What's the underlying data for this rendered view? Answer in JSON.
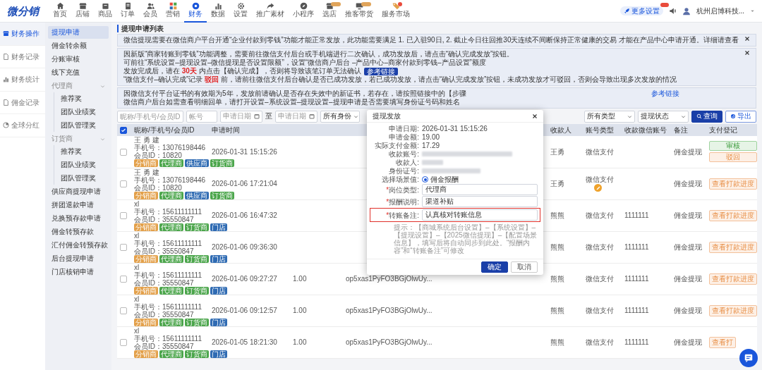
{
  "top_nav": {
    "logo": "微分销",
    "items": [
      {
        "label": "首页",
        "selected": false,
        "badge": false
      },
      {
        "label": "店铺",
        "selected": false,
        "badge": false
      },
      {
        "label": "商品",
        "selected": false,
        "badge": false
      },
      {
        "label": "订单",
        "selected": false,
        "badge": false
      },
      {
        "label": "会员",
        "selected": false,
        "badge": false
      },
      {
        "label": "营销",
        "selected": false,
        "badge": false
      },
      {
        "label": "财务",
        "selected": true,
        "badge": false
      },
      {
        "label": "数据",
        "selected": false,
        "badge": false
      },
      {
        "label": "设置",
        "selected": false,
        "badge": false
      },
      {
        "label": "推广素材",
        "selected": false,
        "badge": false
      },
      {
        "label": "小程序",
        "selected": false,
        "badge": false
      },
      {
        "label": "选店",
        "selected": false,
        "badge": true
      },
      {
        "label": "推客带货",
        "selected": false,
        "badge": true
      },
      {
        "label": "服务市场",
        "selected": false,
        "badge": true
      }
    ],
    "more_settings": {
      "label": "更多设置",
      "badge": true
    },
    "account": "杭州启博科技..."
  },
  "sidebar": {
    "items": [
      {
        "label": "财务操作",
        "selected": true
      },
      {
        "label": "财务记录",
        "selected": false
      },
      {
        "label": "财务统计",
        "selected": false
      },
      {
        "label": "佣金记录",
        "selected": false
      },
      {
        "label": "全球分红",
        "selected": false
      }
    ]
  },
  "subnav": {
    "items": [
      {
        "label": "提现申请",
        "selected": true
      },
      {
        "label": "佣金转余额",
        "selected": false
      },
      {
        "label": "分账审核",
        "selected": false
      },
      {
        "label": "线下充值",
        "selected": false
      },
      {
        "label": "代理商",
        "expanded": true,
        "children": [
          {
            "label": "推荐奖",
            "selected": false
          },
          {
            "label": "团队业绩奖",
            "selected": false
          },
          {
            "label": "团队管理奖",
            "selected": false
          }
        ]
      },
      {
        "label": "订货商",
        "expanded": true,
        "children": [
          {
            "label": "推荐奖",
            "selected": false
          },
          {
            "label": "团队业绩奖",
            "selected": false
          },
          {
            "label": "团队管理奖",
            "selected": false
          }
        ]
      },
      {
        "label": "供应商提现申请",
        "selected": false
      },
      {
        "label": "拼团退款申请",
        "selected": false
      },
      {
        "label": "兑换预存款申请",
        "selected": false
      },
      {
        "label": "佣金转预存款",
        "selected": false
      },
      {
        "label": "汇付佣金转预存款",
        "selected": false
      },
      {
        "label": "后台提现申请",
        "selected": false
      },
      {
        "label": "门店核销申请",
        "selected": false
      }
    ]
  },
  "page_title": "提现申请列表",
  "notices": [
    {
      "closable": true,
      "lines": [
        [
          {
            "kind": "text",
            "text": "微信提现需要在微信商户平台开通“企业付款到零钱”功能才能正常发放，此功能需要满足 1. 已入驻90日, 2. 截止今日往回推30天连续不间断保持正常健康的交易 才能在产品中心申请开通。详细请查看"
          }
        ]
      ]
    },
    {
      "closable": true,
      "lines": [
        [
          {
            "kind": "text",
            "text": "因新版“商家转账到零钱”功能调整，需要前往微信支付后台或手机端进行二次确认，成功发放后，请点击“确认完成发放”按钮。"
          }
        ],
        [
          {
            "kind": "text",
            "text": "可前往“系统设置–提现设置–微信提现是否设置限额”，设置“微信商户后台 –产品中心–商家付款到零钱–产品设置”额度"
          }
        ],
        [
          {
            "kind": "text",
            "text": "发放完成后，请在 "
          },
          {
            "kind": "alert",
            "text": "30天"
          },
          {
            "kind": "text",
            "text": " 内点击【确认完成】，否则将导致该笔订单无法确认"
          },
          {
            "kind": "button",
            "text": "参考链接"
          }
        ],
        [
          {
            "kind": "text",
            "text": "“微信支付–确认完成”记录 "
          },
          {
            "kind": "alert",
            "text": "驳回"
          },
          {
            "kind": "text",
            "text": " 前，请前往微信支付后台确认是否已成功发放，若已成功发放，请点击“确认完成发放”按钮，未成功发放才可驳回，否则会导致出现多次发放的情况"
          }
        ]
      ]
    },
    {
      "closable": false,
      "lines": [
        [
          {
            "kind": "text",
            "text": "因微信支付平台证书的有效期为5年，发放前请确认是否存在失效中的新证书，若存在，请按照链接中的【步骤"
          },
          {
            "kind": "link",
            "text": "参考链接"
          }
        ],
        [
          {
            "kind": "text",
            "text": "微信商户后台如需查看明细回单，请打开设置–系统设置–提现设置–提现申请是否需要填写身份证号码和姓名"
          }
        ]
      ]
    }
  ],
  "filters": [
    {
      "kind": "input",
      "placeholder": "昵称/手机号/会员ID"
    },
    {
      "kind": "input",
      "placeholder": "帐号"
    },
    {
      "kind": "date",
      "placeholder": "申请日期"
    },
    {
      "kind": "text",
      "text": "至"
    },
    {
      "kind": "date",
      "placeholder": "申请日期"
    },
    {
      "kind": "select",
      "value": "所有身份"
    }
  ],
  "filters_right": [
    {
      "kind": "select",
      "value": "所有类型"
    },
    {
      "kind": "select",
      "value": "提现状态"
    },
    {
      "kind": "primary",
      "text": "查询"
    },
    {
      "kind": "outline",
      "text": "导出"
    }
  ],
  "table": {
    "select_all": {
      "checked": true
    },
    "columns": {
      "member": "昵称/手机号/会员ID",
      "time": "申请时间",
      "payee": "收款人",
      "account_type": "账号类型",
      "wechat_account": "收款微信账号",
      "remark": "备注",
      "payment": "支付登记"
    },
    "rows": [
      {
        "checked": false,
        "member": {
          "name": "王 勇 建",
          "phone": "手机号：13076198446",
          "member_id": "会员ID：10820",
          "tags": [
            {
              "label": "分销商",
              "color": "#e3a04a"
            },
            {
              "label": "代理商",
              "color": "#4ca64c"
            },
            {
              "label": "供应商",
              "color": "#2f6bb3"
            },
            {
              "label": "订货商",
              "color": "#4ca64c"
            }
          ]
        },
        "time": "2026-01-31 15:15:26",
        "payee": "王勇",
        "account_type": "微信支付",
        "account_editable": false,
        "remark": "佣金提现",
        "payment": [
          {
            "kind": "approve",
            "label": "审核"
          },
          {
            "kind": "reject",
            "label": "驳回"
          }
        ]
      },
      {
        "checked": false,
        "member": {
          "name": "王 勇 建",
          "phone": "手机号：13076198446",
          "member_id": "会员ID：10820",
          "tags": [
            {
              "label": "分销商",
              "color": "#e3a04a"
            },
            {
              "label": "代理商",
              "color": "#4ca64c"
            },
            {
              "label": "供应商",
              "color": "#2f6bb3"
            },
            {
              "label": "订货商",
              "color": "#4ca64c"
            }
          ]
        },
        "time": "2026-01-06 17:21:04",
        "payee": "王勇",
        "account_type": "微信支付",
        "account_editable": true,
        "remark": "佣金提现",
        "payment": [
          {
            "kind": "progress",
            "label": "查看打款进度"
          }
        ]
      },
      {
        "checked": false,
        "member": {
          "name": "xl",
          "phone": "手机号：15611111111",
          "member_id": "会员ID：35550847",
          "tags": [
            {
              "label": "分销商",
              "color": "#e3a04a"
            },
            {
              "label": "代理商",
              "color": "#4ca64c"
            },
            {
              "label": "订货商",
              "color": "#4ca64c"
            },
            {
              "label": "门店",
              "color": "#2f6bb3"
            }
          ]
        },
        "time": "2026-01-06 16:47:32",
        "payee": "熊熊",
        "account_type": "微信支付",
        "account_editable": false,
        "wechat_account": "1111111",
        "remark": "佣金提现",
        "payment": [
          {
            "kind": "progress",
            "label": "查看打款进度"
          }
        ]
      },
      {
        "checked": false,
        "member": {
          "name": "xl",
          "phone": "手机号：15611111111",
          "member_id": "会员ID：35550847",
          "tags": [
            {
              "label": "分销商",
              "color": "#e3a04a"
            },
            {
              "label": "代理商",
              "color": "#4ca64c"
            },
            {
              "label": "订货商",
              "color": "#4ca64c"
            },
            {
              "label": "门店",
              "color": "#2f6bb3"
            }
          ]
        },
        "time": "2026-01-06 09:36:30",
        "payee": "熊熊",
        "account_type": "微信支付",
        "account_editable": false,
        "wechat_account": "1111111",
        "remark": "佣金提现",
        "payment": [
          {
            "kind": "progress",
            "label": "查看打款进度"
          }
        ]
      },
      {
        "checked": false,
        "member": {
          "name": "xl",
          "phone": "手机号：15611111111",
          "member_id": "会员ID：35550847",
          "tags": [
            {
              "label": "分销商",
              "color": "#e3a04a"
            },
            {
              "label": "代理商",
              "color": "#4ca64c"
            },
            {
              "label": "订货商",
              "color": "#4ca64c"
            },
            {
              "label": "门店",
              "color": "#2f6bb3"
            }
          ]
        },
        "time": "2026-01-06 09:27:27",
        "column_3": "1.00",
        "column_4": "op5xas1PyFO3BGjOlwUy...",
        "payee": "熊熊",
        "account_type": "微信支付",
        "account_editable": false,
        "wechat_account": "1111111",
        "remark": "佣金提现",
        "payment": [
          {
            "kind": "progress",
            "label": "查看打款进度"
          }
        ]
      },
      {
        "checked": false,
        "member": {
          "name": "xl",
          "phone": "手机号：15611111111",
          "member_id": "会员ID：35550847",
          "tags": [
            {
              "label": "分销商",
              "color": "#e3a04a"
            },
            {
              "label": "代理商",
              "color": "#4ca64c"
            },
            {
              "label": "订货商",
              "color": "#4ca64c"
            },
            {
              "label": "门店",
              "color": "#2f6bb3"
            }
          ]
        },
        "time": "2026-01-06 09:12:57",
        "column_3": "1.00",
        "column_4": "op5xas1PyFO3BGjOlwUy...",
        "payee": "熊熊",
        "account_type": "微信支付",
        "account_editable": false,
        "wechat_account": "1111111",
        "remark": "佣金提现",
        "payment": [
          {
            "kind": "progress",
            "label": "查看打款进度"
          }
        ]
      },
      {
        "checked": false,
        "member": {
          "name": "xl",
          "phone": "手机号：15611111111",
          "member_id": "会员ID：35550847",
          "tags": [
            {
              "label": "分销商",
              "color": "#e3a04a"
            },
            {
              "label": "代理商",
              "color": "#4ca64c"
            },
            {
              "label": "订货商",
              "color": "#4ca64c"
            },
            {
              "label": "门店",
              "color": "#2f6bb3"
            }
          ]
        },
        "time": "2026-01-05 18:21:30",
        "column_3": "1.00",
        "column_4": "op5xas1PyFO3BGjOlwUy...",
        "payee": "熊熊",
        "account_type": "微信支付",
        "account_editable": false,
        "wechat_account": "1111111",
        "remark": "佣金提现",
        "payment": [
          {
            "kind": "progress",
            "label": "查看打"
          }
        ]
      }
    ]
  },
  "dialog": {
    "title": "提现发放",
    "fields": [
      {
        "kind": "info",
        "label": "申请日期:",
        "value": "2026-01-31 15:15:26"
      },
      {
        "kind": "info",
        "label": "申请金额:",
        "value": "19.00"
      },
      {
        "kind": "info",
        "label": "实际支付金额:",
        "value": "17.29"
      },
      {
        "kind": "redacted",
        "label": "收款账号:"
      },
      {
        "kind": "redacted",
        "label": "收款人:"
      },
      {
        "kind": "redacted",
        "label": "身份证号:"
      },
      {
        "kind": "radio",
        "label": "选择场景值:",
        "options": [
          {
            "label": "佣金报酬",
            "selected": true
          }
        ]
      },
      {
        "kind": "input",
        "required_mark": "*",
        "label": "岗位类型:",
        "value": "代理商",
        "highlighted": false
      },
      {
        "kind": "input",
        "required_mark": "*",
        "label": "报酬说明:",
        "value": "渠道补贴",
        "highlighted": false
      },
      {
        "kind": "input",
        "required_mark": "*",
        "label": "转账备注:",
        "value": "认真核对转账信息",
        "highlighted": true
      }
    ],
    "hint": "提示：【商城系统后台设置】–【系统设置】–【提现设置】–【2025微信提现】–【配置场景信息】，填写后将自动同步到此处。“报酬内容”和“转账备注”可修改",
    "buttons": [
      {
        "kind": "primary",
        "label": "确定"
      },
      {
        "kind": "secondary",
        "label": "取消"
      }
    ]
  }
}
